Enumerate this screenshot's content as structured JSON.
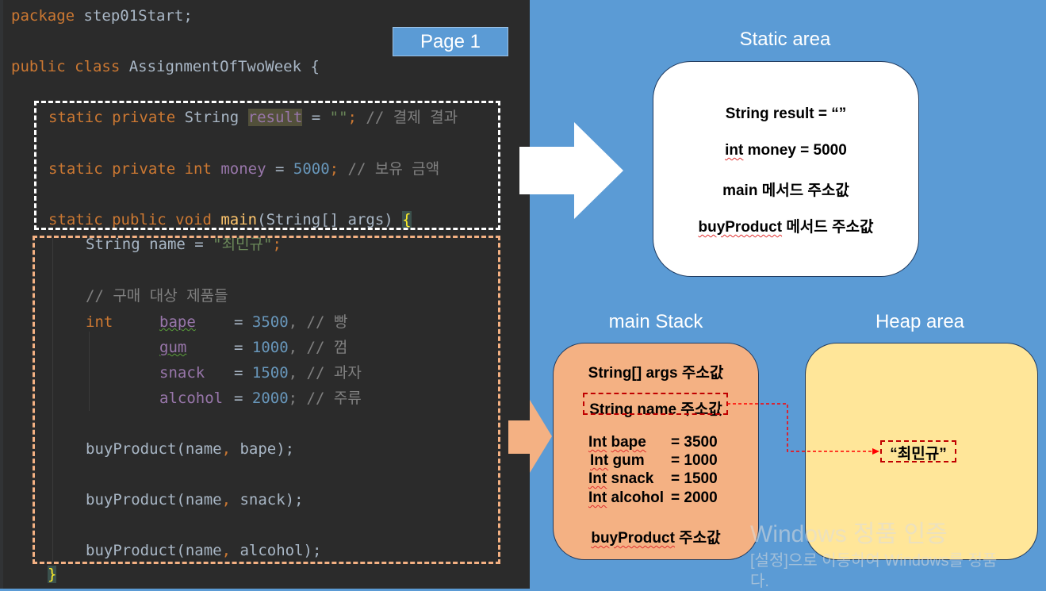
{
  "code": {
    "lines": {
      "l1_a": "package",
      "l1_b": " step01Start;",
      "l2_a": "public class",
      "l2_b": " AssignmentOfTwoWeek {",
      "l3_a": "static private",
      "l3_b": " String ",
      "l3_c": "result",
      "l3_d": " = ",
      "l3_e": "\"\"",
      "l3_f": "; ",
      "l3_g": "// 결제 결과",
      "l4_a": "static private int",
      "l4_b": " ",
      "l4_c": "money",
      "l4_d": " = ",
      "l4_e": "5000",
      "l4_f": "; ",
      "l4_g": "// 보유 금액",
      "l5_a": "static public void",
      "l5_b": " ",
      "l5_c": "main",
      "l5_d": "(String[] args) ",
      "l5_e": "{",
      "l6_a": "String name = ",
      "l6_b": "\"최민규\"",
      "l6_c": ";",
      "l7": "// 구매 대상 제품들",
      "l8_a": "int",
      "l8_b": "bape",
      "l8_c": "=",
      "l8_d": "3500",
      "l8_e": ", // 빵",
      "l9_b": "gum",
      "l9_c": "=",
      "l9_d": "1000",
      "l9_e": ", // 껌",
      "l10_b": "snack",
      "l10_c": "=",
      "l10_d": "1500",
      "l10_e": ", // 과자",
      "l11_b": "alcohol",
      "l11_c": "=",
      "l11_d": "2000",
      "l11_e": "; // 주류",
      "l12_a": "buyProduct(name",
      "l12_b": ",",
      "l12_c": " bape);",
      "l13_a": "buyProduct(name",
      "l13_b": ",",
      "l13_c": " snack);",
      "l14_a": "buyProduct(name",
      "l14_b": ",",
      "l14_c": " alcohol);",
      "l15": "}"
    },
    "page_label": "Page 1"
  },
  "static_area": {
    "title": "Static area",
    "items": [
      "String result = “”",
      "money = 5000",
      "main 메서드 주소값",
      "메서드 주소값"
    ],
    "item2_prefix": "int",
    "item4_prefix": "buyProduct"
  },
  "main_stack": {
    "title": "main Stack",
    "args": "String[] args 주소값",
    "name_ref": "String name 주소값",
    "vars": [
      {
        "kw": "Int",
        "name": "bape",
        "value": "= 3500"
      },
      {
        "kw": "Int",
        "name": "gum",
        "value": "= 1000"
      },
      {
        "kw": "Int",
        "name": "snack",
        "value": "= 1500"
      },
      {
        "kw": "Int",
        "name": "alcohol",
        "value": "= 2000"
      }
    ],
    "buy_prefix": "buyProduct",
    "buy_suffix": " 주소값"
  },
  "heap_area": {
    "title": "Heap area",
    "value": "“최민규”"
  },
  "watermark": {
    "line1": "Windows 정품 인증",
    "line2": "[설정]으로 이동하여 Windows를 정품",
    "line3": "다."
  },
  "colors": {
    "background": "#5b9bd5",
    "code_bg": "#2b2b2b",
    "stack_fill": "#f4b183",
    "heap_fill": "#ffe699",
    "ref_line": "#ff0000"
  }
}
